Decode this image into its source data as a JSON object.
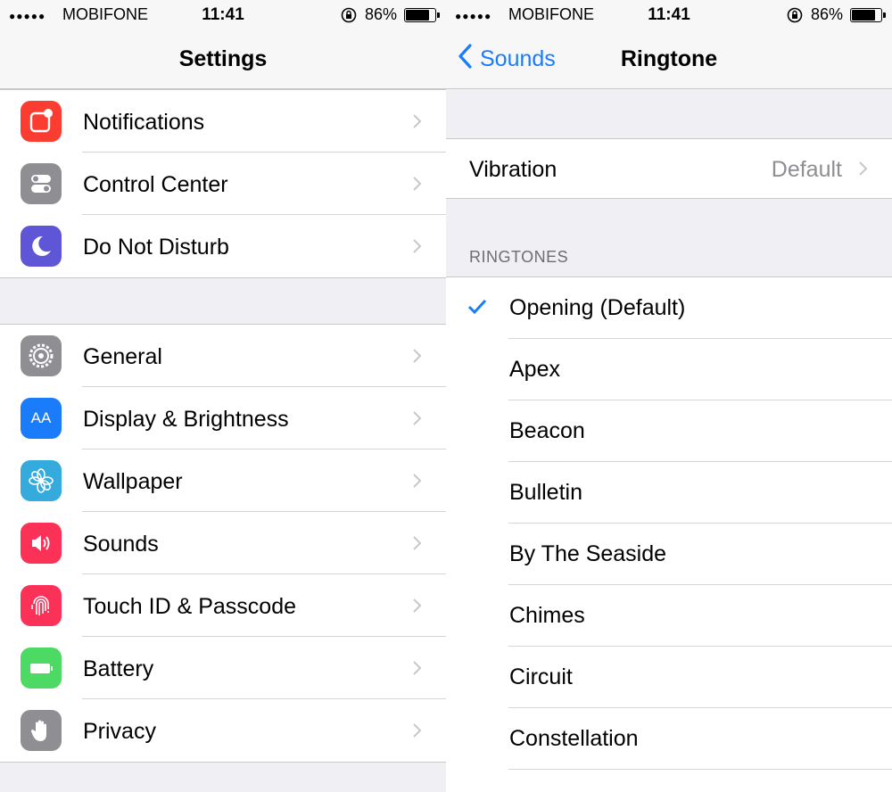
{
  "status_bar": {
    "signal": "●●●●●",
    "carrier": "MOBIFONE",
    "time": "11:41",
    "battery_percent": "86%",
    "battery_level": 0.86
  },
  "left": {
    "title": "Settings",
    "group1": [
      {
        "label": "Notifications",
        "icon": "notifications-icon",
        "color": "#fb3d31"
      },
      {
        "label": "Control Center",
        "icon": "control-center-icon",
        "color": "#8e8e93"
      },
      {
        "label": "Do Not Disturb",
        "icon": "moon-icon",
        "color": "#5f56d7"
      }
    ],
    "group2": [
      {
        "label": "General",
        "icon": "gear-icon",
        "color": "#8e8e93"
      },
      {
        "label": "Display & Brightness",
        "icon": "display-icon",
        "color": "#1a7cf8",
        "icon_text": "AA"
      },
      {
        "label": "Wallpaper",
        "icon": "flower-icon",
        "color": "#35aadc"
      },
      {
        "label": "Sounds",
        "icon": "speaker-icon",
        "color": "#fc3158"
      },
      {
        "label": "Touch ID & Passcode",
        "icon": "fingerprint-icon",
        "color": "#fc3158"
      },
      {
        "label": "Battery",
        "icon": "battery-icon",
        "color": "#4cd964"
      },
      {
        "label": "Privacy",
        "icon": "hand-icon",
        "color": "#8e8e93"
      }
    ]
  },
  "right": {
    "back_label": "Sounds",
    "title": "Ringtone",
    "vibration": {
      "label": "Vibration",
      "value": "Default"
    },
    "section_header": "RINGTONES",
    "ringtones": [
      {
        "label": "Opening (Default)",
        "selected": true
      },
      {
        "label": "Apex",
        "selected": false
      },
      {
        "label": "Beacon",
        "selected": false
      },
      {
        "label": "Bulletin",
        "selected": false
      },
      {
        "label": "By The Seaside",
        "selected": false
      },
      {
        "label": "Chimes",
        "selected": false
      },
      {
        "label": "Circuit",
        "selected": false
      },
      {
        "label": "Constellation",
        "selected": false
      }
    ]
  }
}
